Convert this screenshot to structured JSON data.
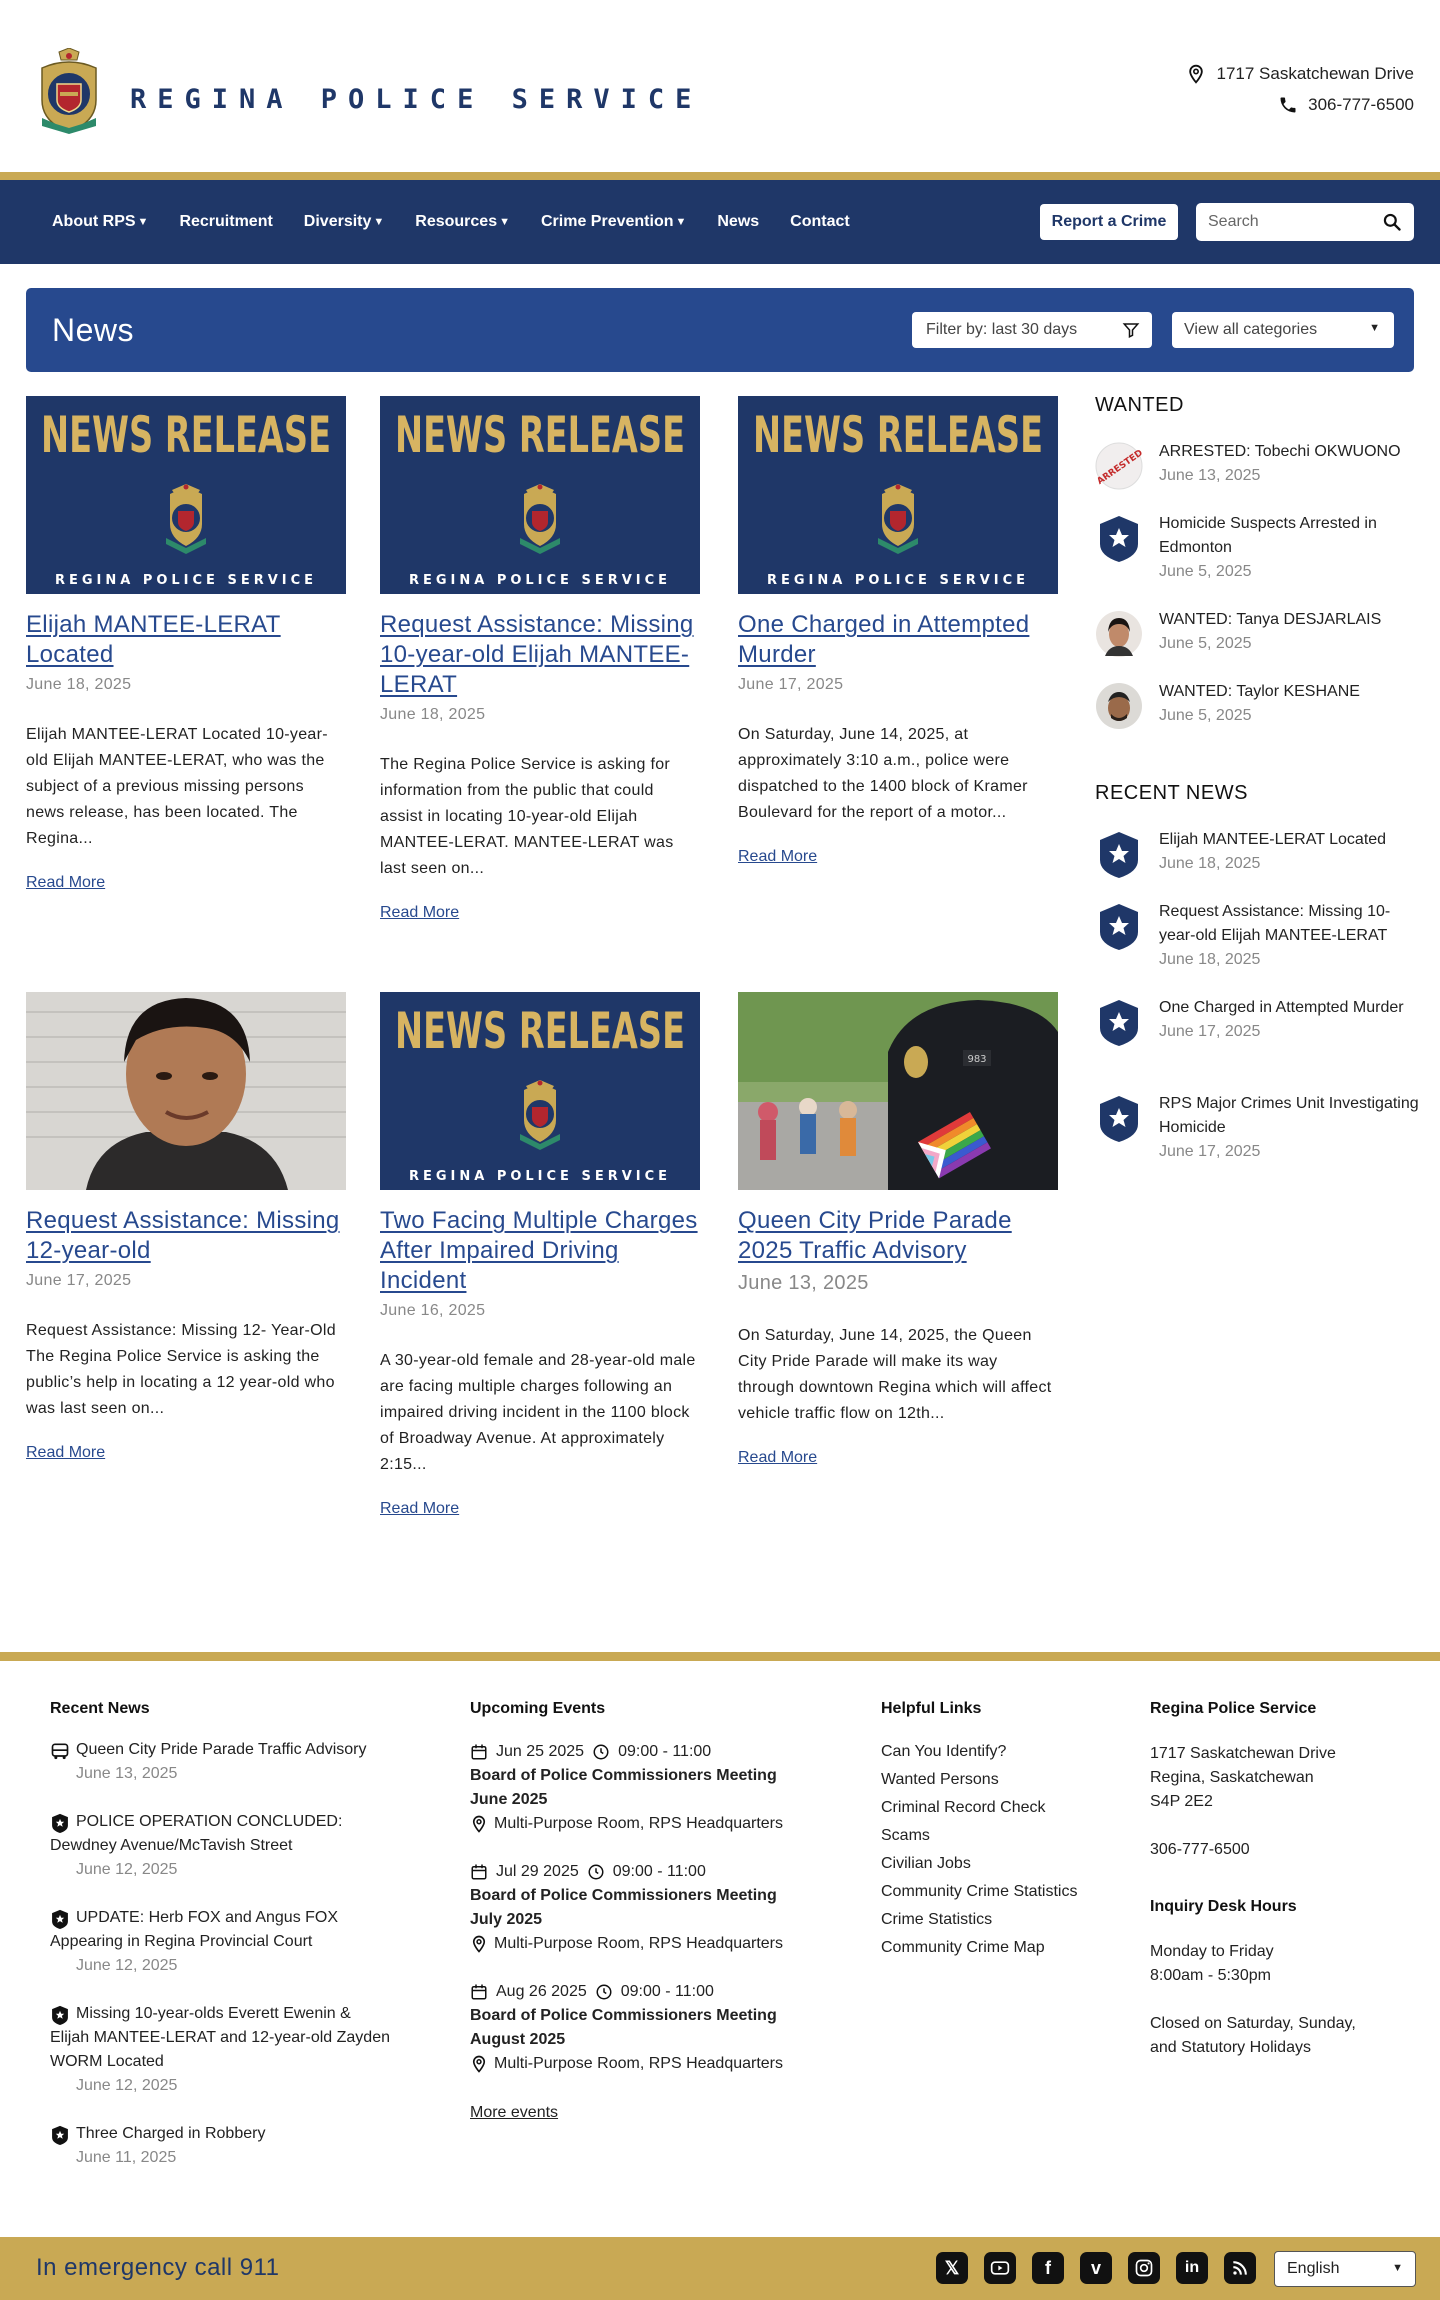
{
  "brand": {
    "title": "REGINA POLICE SERVICE",
    "address": "1717 Saskatchewan Drive",
    "phone": "306-777-6500"
  },
  "nav": {
    "items": [
      {
        "label": "About RPS",
        "dropdown": true
      },
      {
        "label": "Recruitment",
        "dropdown": false
      },
      {
        "label": "Diversity",
        "dropdown": true
      },
      {
        "label": "Resources",
        "dropdown": true
      },
      {
        "label": "Crime Prevention",
        "dropdown": true
      },
      {
        "label": "News",
        "dropdown": false
      },
      {
        "label": "Contact",
        "dropdown": false
      }
    ],
    "report_label": "Report a Crime",
    "search_placeholder": "Search"
  },
  "news_header": {
    "title": "News",
    "filter_label": "Filter by: last 30 days",
    "category_label": "View all categories"
  },
  "thumb_text": {
    "headline": "NEWS RELEASE",
    "org": "REGINA POLICE SERVICE"
  },
  "articles": [
    {
      "title": "Elijah MANTEE-LERAT Located",
      "date": "June 18, 2025",
      "excerpt": "Elijah MANTEE-LERAT Located   10-year-old Elijah MANTEE-LERAT, who was the subject of a previous missing persons news release, has been located. The Regina...",
      "more": "Read More",
      "image": "news-release"
    },
    {
      "title": "Request Assistance: Missing 10-year-old Elijah MANTEE-LERAT",
      "date": "June 18, 2025",
      "excerpt": "The Regina Police Service is asking for information from the public that could assist in locating 10-year-old Elijah MANTEE-LERAT. MANTEE-LERAT was last seen on...",
      "more": "Read More",
      "image": "news-release"
    },
    {
      "title": "One Charged in Attempted Murder",
      "date": "June 17, 2025",
      "excerpt": "On Saturday, June 14, 2025, at approximately 3:10 a.m., police were dispatched to the 1400 block of Kramer Boulevard for the report of a motor...",
      "more": "Read More",
      "image": "news-release"
    },
    {
      "title": "Request Assistance: Missing 12-year-old",
      "date": "June 17, 2025",
      "excerpt": "Request Assistance: Missing 12- Year-Old   The Regina Police Service is asking the public’s help in locating a 12 year-old who was last seen on...",
      "more": "Read More",
      "image": "portrait"
    },
    {
      "title": "Two Facing Multiple Charges After Impaired Driving Incident",
      "date": "June 16, 2025",
      "excerpt": "A 30-year-old female and 28-year-old male are facing multiple charges following an impaired driving incident in the 1100 block of Broadway Avenue. At approximately 2:15...",
      "more": "Read More",
      "image": "news-release"
    },
    {
      "title": "Queen City Pride Parade 2025 Traffic Advisory",
      "date": "June 13, 2025",
      "excerpt": "On Saturday, June 14, 2025, the Queen City Pride Parade will make its way through downtown Regina which will affect vehicle traffic flow on 12th...",
      "more": "Read More",
      "image": "officer-pride"
    }
  ],
  "sidebar": {
    "wanted_heading": "WANTED",
    "wanted": [
      {
        "title": "ARRESTED: Tobechi OKWUONO",
        "date": "June 13, 2025",
        "icon": "arrested-stamp-icon"
      },
      {
        "title": "Homicide Suspects Arrested in Edmonton",
        "date": "June 5, 2025",
        "icon": "badge-icon"
      },
      {
        "title": "WANTED: Tanya DESJARLAIS",
        "date": "June 5, 2025",
        "icon": "portrait-icon"
      },
      {
        "title": "WANTED: Taylor KESHANE",
        "date": "June 5, 2025",
        "icon": "portrait-icon"
      }
    ],
    "recent_heading": "RECENT NEWS",
    "recent": [
      {
        "title": "Elijah MANTEE-LERAT Located",
        "date": "June 18, 2025"
      },
      {
        "title": "Request Assistance: Missing 10-year-old Elijah MANTEE-LERAT",
        "date": "June 18, 2025"
      },
      {
        "title": "One Charged in Attempted Murder",
        "date": "June 17, 2025"
      },
      {
        "title": "RPS Major Crimes Unit Investigating Homicide",
        "date": "June 17, 2025"
      }
    ]
  },
  "footer": {
    "recent_heading": "Recent News",
    "recent": [
      {
        "title": "Queen City Pride Parade Traffic Advisory",
        "date": "June 13, 2025",
        "icon": "bus-icon"
      },
      {
        "title": "POLICE OPERATION CONCLUDED: Dewdney Avenue/McTavish Street",
        "date": "June 12, 2025",
        "icon": "badge-icon"
      },
      {
        "title": "UPDATE: Herb FOX and Angus FOX Appearing in Regina Provincial Court",
        "date": "June 12, 2025",
        "icon": "badge-icon"
      },
      {
        "title": "Missing 10-year-olds Everett Ewenin & Elijah MANTEE-LERAT and 12-year-old Zayden WORM Located",
        "date": "June 12, 2025",
        "icon": "badge-icon"
      },
      {
        "title": "Three Charged in Robbery",
        "date": "June 11, 2025",
        "icon": "badge-icon"
      }
    ],
    "events_heading": "Upcoming Events",
    "events": [
      {
        "date": "Jun 25 2025",
        "time": "09:00 - 11:00",
        "title": "Board of Police Commissioners Meeting June 2025",
        "location": "Multi-Purpose Room, RPS Headquarters"
      },
      {
        "date": "Jul 29 2025",
        "time": "09:00 - 11:00",
        "title": "Board of Police Commissioners Meeting July 2025",
        "location": "Multi-Purpose Room, RPS Headquarters"
      },
      {
        "date": "Aug 26 2025",
        "time": "09:00 - 11:00",
        "title": "Board of Police Commissioners Meeting August 2025",
        "location": "Multi-Purpose Room, RPS Headquarters"
      }
    ],
    "more_events": "More events",
    "links_heading": "Helpful Links",
    "links": [
      "Can You Identify?",
      "Wanted Persons",
      "Criminal Record Check",
      "Scams",
      "Civilian Jobs",
      "Community Crime Statistics",
      "Crime Statistics",
      "Community Crime Map"
    ],
    "rps_heading": "Regina Police Service",
    "address_lines": [
      "1717 Saskatchewan Drive",
      "Regina, Saskatchewan",
      "S4P 2E2"
    ],
    "phone": "306-777-6500",
    "hours_heading": "Inquiry Desk Hours",
    "hours_lines": [
      "Monday to Friday",
      "8:00am - 5:30pm"
    ],
    "closed_lines": [
      "Closed on Saturday, Sunday,",
      "and Statutory Holidays"
    ]
  },
  "bottom": {
    "emergency": "In emergency call 911",
    "socials": [
      "x-icon",
      "youtube-icon",
      "facebook-icon",
      "vimeo-icon",
      "instagram-icon",
      "linkedin-icon",
      "rss-icon"
    ],
    "language": "English"
  },
  "colors": {
    "navy": "#1f3768",
    "blue": "#27498e",
    "gold": "#c9a954"
  }
}
